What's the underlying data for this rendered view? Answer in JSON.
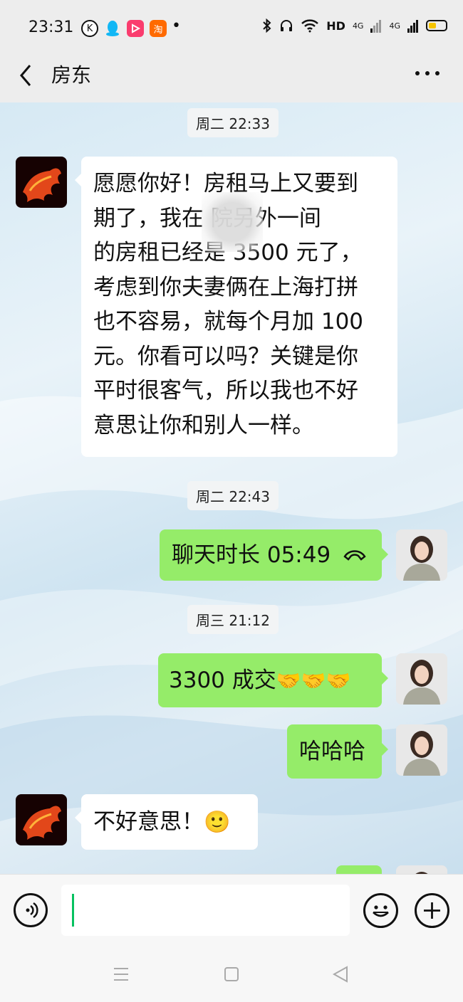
{
  "status_bar": {
    "time": "23:31",
    "app_icons": [
      "k-app-icon",
      "qq-penguin-icon",
      "video-play-icon",
      "taobao-icon"
    ],
    "app_labels": {
      "k": "K",
      "taobao": "淘"
    },
    "dot": "•",
    "hd_label": "HD",
    "network_label": "4G",
    "battery_level": 0.45,
    "battery_color": "#f5c400"
  },
  "header": {
    "title": "房东"
  },
  "messages": {
    "time1": "周二 22:33",
    "msg1_lines": [
      "愿愿你好！房租马上又要到",
      "期了，我在     院另外一间",
      "的房租已经是 3500 元了，",
      "考虑到你夫妻俩在上海打拼",
      "也不容易，就每个月加 100",
      "元。你看可以吗？关键是你",
      "平时很客气，所以我也不好",
      "意思让你和别人一样。"
    ],
    "time2": "周二 22:43",
    "call_text": "聊天时长 05:49",
    "time3": "周三 21:12",
    "deal_text": "3300 成交",
    "deal_emoji": "🤝🤝🤝",
    "haha_text": "哈哈哈",
    "sorry_text": "不好意思！",
    "sorry_emoji": "🙂"
  },
  "colors": {
    "sent_bubble": "#95ec69",
    "received_bubble": "#ffffff",
    "caret": "#07c160"
  },
  "input": {
    "value": "",
    "placeholder": ""
  }
}
